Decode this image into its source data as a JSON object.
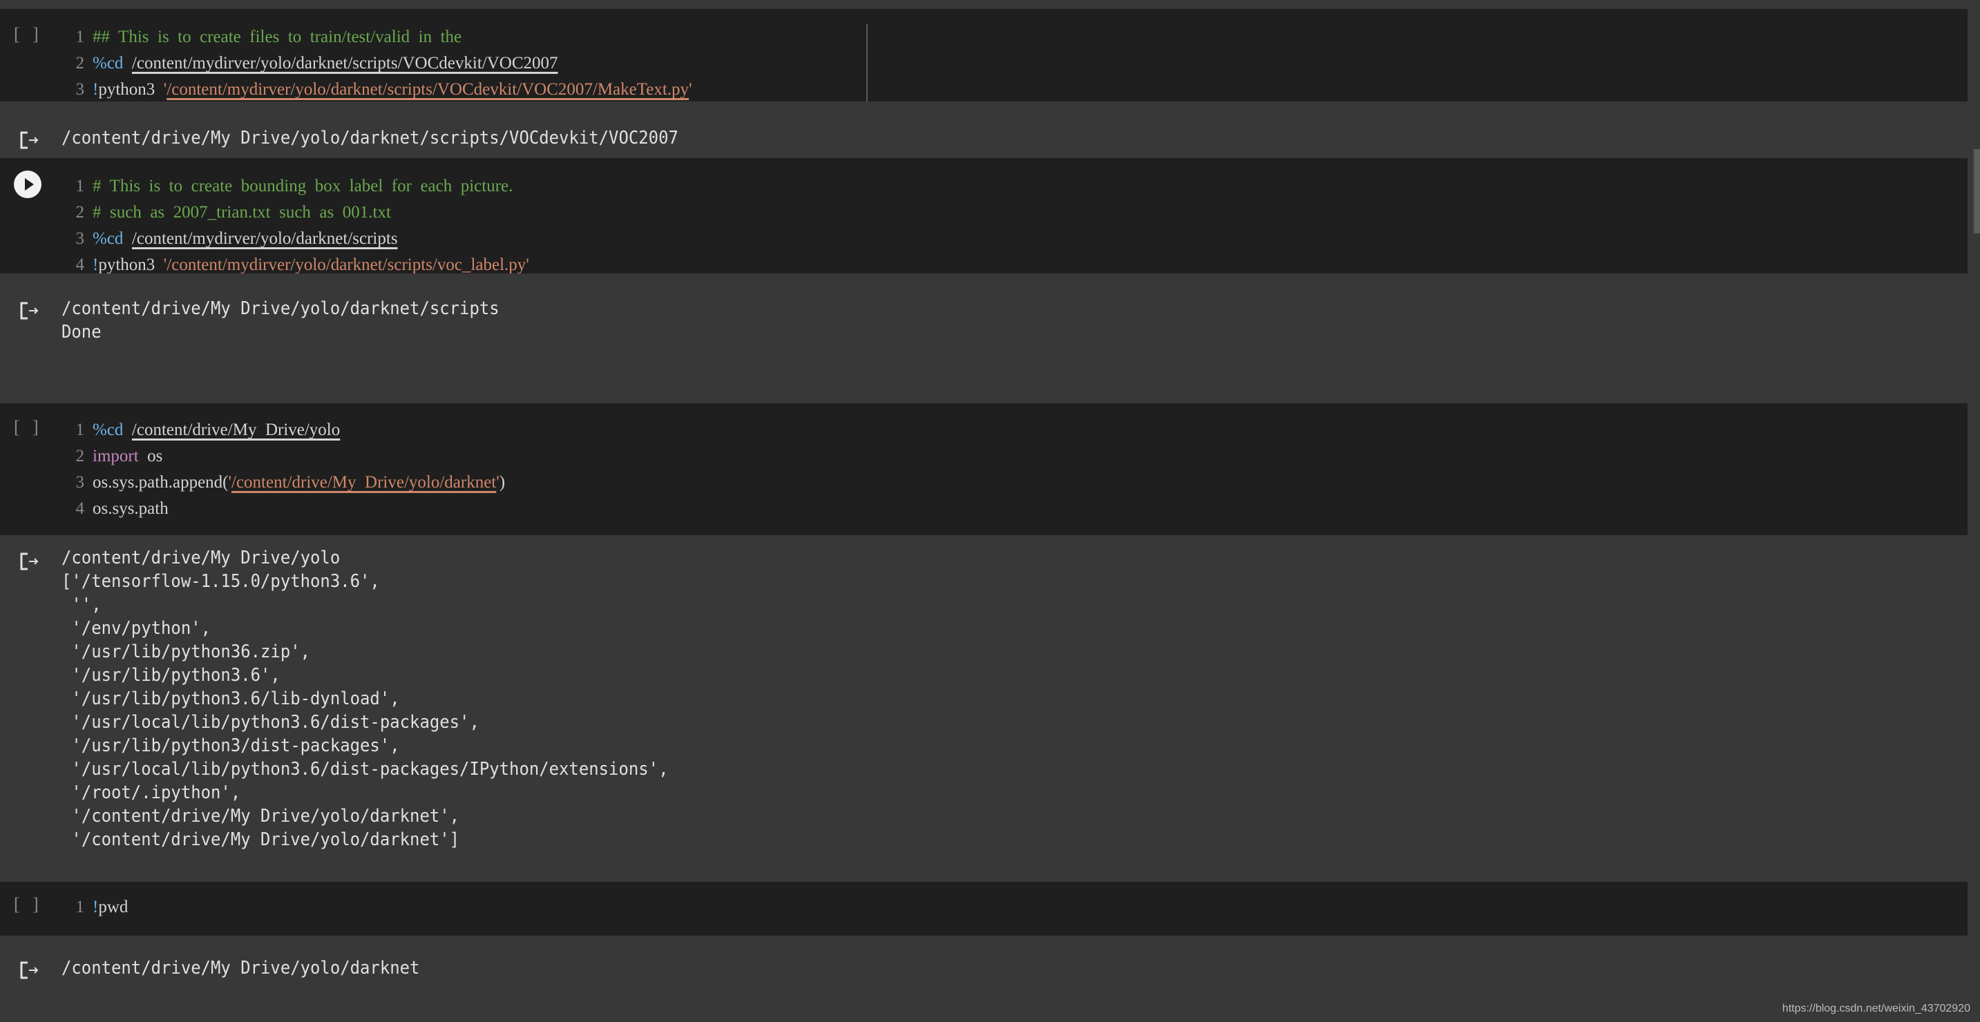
{
  "cells": [
    {
      "state": "idle",
      "run_label": "[ ]",
      "lines": [
        {
          "n": "1",
          "tokens": [
            {
              "t": "##  This  is  to  create  files  to  train/test/valid  in  the",
              "c": "cm"
            }
          ]
        },
        {
          "n": "2",
          "tokens": [
            {
              "t": "%cd",
              "c": "mg"
            },
            {
              "t": "  ",
              "c": "pl"
            },
            {
              "t": "/content/mydirver/yolo/darknet/scripts/VOCdevkit/VOC2007",
              "c": "pl ul"
            }
          ]
        },
        {
          "n": "3",
          "tokens": [
            {
              "t": "!",
              "c": "mg"
            },
            {
              "t": "python3  ",
              "c": "pl"
            },
            {
              "t": "'",
              "c": "str-q"
            },
            {
              "t": "/content/mydirver/yolo/darknet/scripts/VOCdevkit/VOC2007/MakeText.py",
              "c": "str"
            },
            {
              "t": "'",
              "c": "str-q"
            }
          ]
        }
      ],
      "output": [
        "/content/drive/My Drive/yolo/darknet/scripts/VOCdevkit/VOC2007"
      ]
    },
    {
      "state": "run-hover",
      "run_label": "",
      "lines": [
        {
          "n": "1",
          "tokens": [
            {
              "t": "#  This  is  to  create  bounding  box  label  for  each  picture.",
              "c": "cm"
            }
          ]
        },
        {
          "n": "2",
          "tokens": [
            {
              "t": "#  such  as  2007_trian.txt  such  as  001.txt",
              "c": "cm"
            }
          ]
        },
        {
          "n": "3",
          "tokens": [
            {
              "t": "%cd",
              "c": "mg"
            },
            {
              "t": "  ",
              "c": "pl"
            },
            {
              "t": "/content/mydirver/yolo/darknet/scripts",
              "c": "pl ul"
            }
          ]
        },
        {
          "n": "4",
          "tokens": [
            {
              "t": "!",
              "c": "mg"
            },
            {
              "t": "python3  ",
              "c": "pl"
            },
            {
              "t": "'",
              "c": "str-q"
            },
            {
              "t": "/content/mydirver/yolo/darknet/scripts/voc_label.py",
              "c": "str"
            },
            {
              "t": "'",
              "c": "str-q"
            }
          ]
        }
      ],
      "output": [
        "/content/drive/My Drive/yolo/darknet/scripts",
        "Done"
      ]
    },
    {
      "state": "idle",
      "run_label": "[ ]",
      "lines": [
        {
          "n": "1",
          "tokens": [
            {
              "t": "%cd",
              "c": "mg"
            },
            {
              "t": "  ",
              "c": "pl"
            },
            {
              "t": "/content/drive/My  Drive/yolo",
              "c": "pl ul"
            }
          ]
        },
        {
          "n": "2",
          "tokens": [
            {
              "t": "import",
              "c": "kw"
            },
            {
              "t": "  os",
              "c": "pl"
            }
          ]
        },
        {
          "n": "3",
          "tokens": [
            {
              "t": "os.sys.path.append(",
              "c": "pl"
            },
            {
              "t": "'",
              "c": "str-q"
            },
            {
              "t": "/content/drive/My  Drive/yolo/darknet",
              "c": "str"
            },
            {
              "t": "'",
              "c": "str-q"
            },
            {
              "t": ")",
              "c": "pl"
            }
          ]
        },
        {
          "n": "4",
          "tokens": [
            {
              "t": "os.sys.path",
              "c": "pl"
            }
          ]
        }
      ],
      "output": [
        "/content/drive/My Drive/yolo",
        "['/tensorflow-1.15.0/python3.6',",
        " '',",
        " '/env/python',",
        " '/usr/lib/python36.zip',",
        " '/usr/lib/python3.6',",
        " '/usr/lib/python3.6/lib-dynload',",
        " '/usr/local/lib/python3.6/dist-packages',",
        " '/usr/lib/python3/dist-packages',",
        " '/usr/local/lib/python3.6/dist-packages/IPython/extensions',",
        " '/root/.ipython',",
        " '/content/drive/My Drive/yolo/darknet',",
        " '/content/drive/My Drive/yolo/darknet']"
      ]
    },
    {
      "state": "idle",
      "run_label": "[ ]",
      "lines": [
        {
          "n": "1",
          "tokens": [
            {
              "t": "!",
              "c": "mg"
            },
            {
              "t": "pwd",
              "c": "pl"
            }
          ]
        }
      ],
      "output": [
        "/content/drive/My Drive/yolo/darknet"
      ]
    }
  ],
  "icons": {
    "run": "play-icon",
    "output": "output-arrow-icon"
  },
  "watermark": "https://blog.csdn.net/weixin_43702920",
  "colors": {
    "comment": "#6aa84f",
    "magic": "#6fb3e6",
    "keyword": "#c586c0",
    "string": "#d1876a",
    "code_bg": "#1f1f1f",
    "output_bg": "#383838"
  }
}
